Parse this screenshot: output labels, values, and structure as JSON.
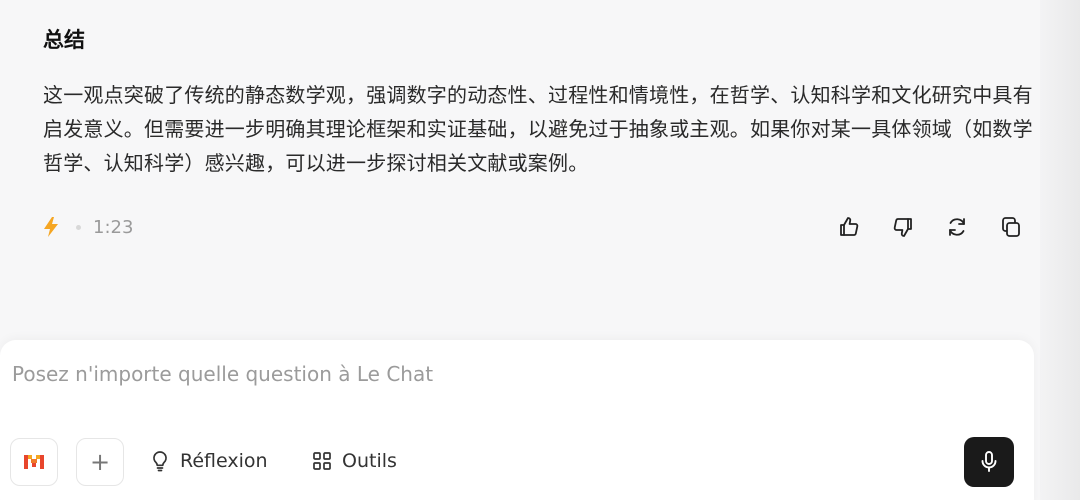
{
  "message": {
    "section_title": "总结",
    "body": "这一观点突破了传统的静态数学观，强调数字的动态性、过程性和情境性，在哲学、认知科学和文化研究中具有启发意义。但需要进一步明确其理论框架和实证基础，以避免过于抽象或主观。如果你对某一具体领域（如数学哲学、认知科学）感兴趣，可以进一步探讨相关文献或案例。",
    "duration": "1:23",
    "speed_icon": "lightning-icon"
  },
  "actions": {
    "thumbs_up_icon": "thumbs-up-icon",
    "thumbs_down_icon": "thumbs-down-icon",
    "regenerate_icon": "refresh-icon",
    "copy_icon": "copy-icon"
  },
  "composer": {
    "placeholder": "Posez n'importe quelle question à Le Chat",
    "plus_label": "+",
    "reflexion_label": "Réflexion",
    "outils_label": "Outils"
  },
  "colors": {
    "accent_orange": "#f5a623",
    "brand_red": "#e8452c",
    "mic_bg": "#1a1a1a"
  }
}
